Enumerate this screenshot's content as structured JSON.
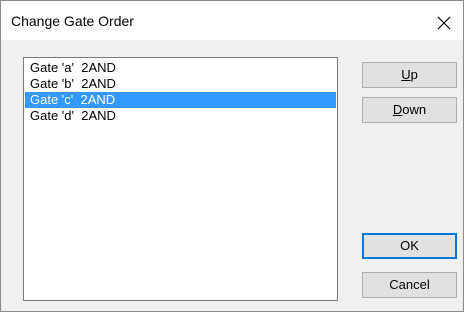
{
  "dialog": {
    "title": "Change Gate Order",
    "close_icon": "close-icon"
  },
  "list": {
    "items": [
      {
        "label": "Gate 'a'  2AND",
        "selected": false
      },
      {
        "label": "Gate 'b'  2AND",
        "selected": false
      },
      {
        "label": "Gate 'c'  2AND",
        "selected": true
      },
      {
        "label": "Gate 'd'  2AND",
        "selected": false
      }
    ],
    "selection_color": "#3399ff"
  },
  "buttons": {
    "up": {
      "mnemonic": "U",
      "rest": "p"
    },
    "down": {
      "mnemonic": "D",
      "rest": "own"
    },
    "ok": "OK",
    "cancel": "Cancel"
  },
  "colors": {
    "accent": "#0078d7",
    "window_bg": "#f0f0f0"
  }
}
